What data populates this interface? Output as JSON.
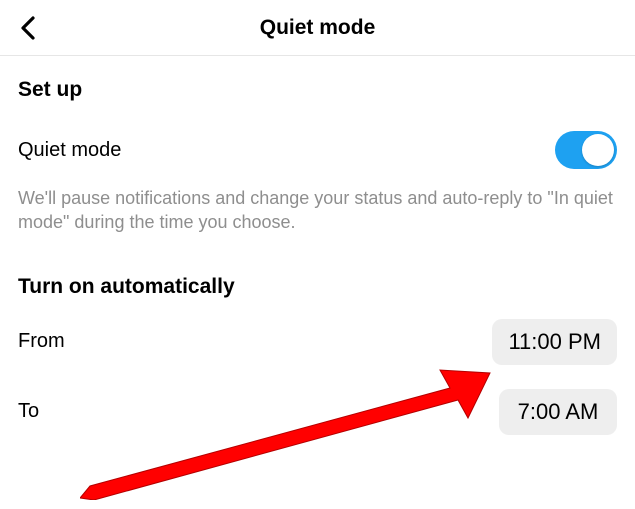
{
  "header": {
    "title": "Quiet mode"
  },
  "setup": {
    "heading": "Set up",
    "toggle_label": "Quiet mode",
    "description": "We'll pause notifications and change your status and auto-reply to \"In quiet mode\" during the time you choose."
  },
  "auto": {
    "heading": "Turn on automatically",
    "from_label": "From",
    "from_value": "11:00 PM",
    "to_label": "To",
    "to_value": "7:00 AM"
  },
  "colors": {
    "toggle_on": "#1ea1f1",
    "arrow": "#ff0000"
  }
}
